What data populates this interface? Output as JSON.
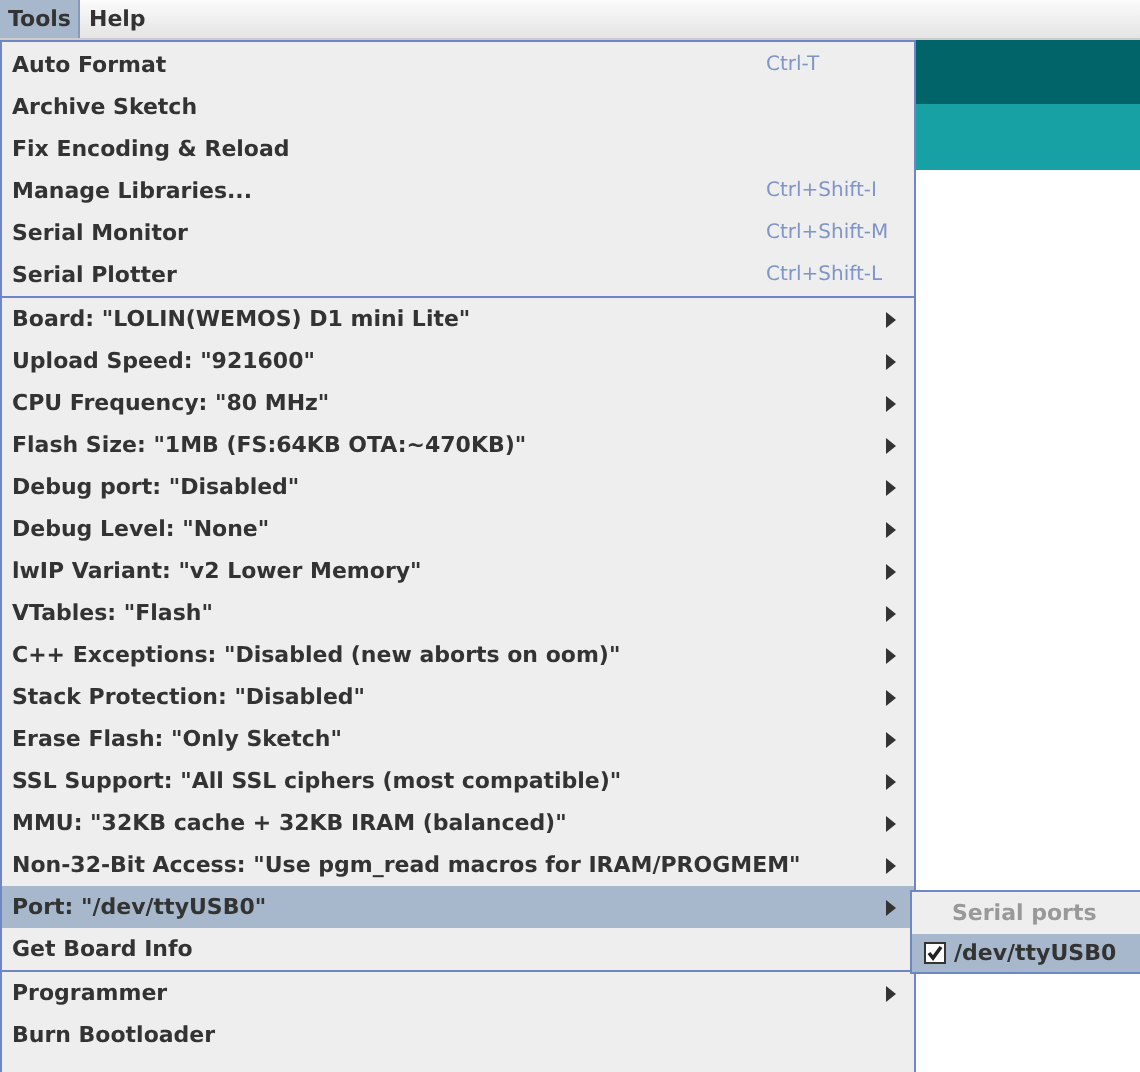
{
  "menubar": [
    {
      "label": "Tools",
      "selected": true
    },
    {
      "label": "Help",
      "selected": false
    }
  ],
  "menu_sections": [
    {
      "items": [
        {
          "label": "Auto Format",
          "shortcut": "Ctrl-T",
          "submenu": false,
          "selected": false
        },
        {
          "label": "Archive Sketch",
          "submenu": false,
          "selected": false
        },
        {
          "label": "Fix Encoding & Reload",
          "submenu": false,
          "selected": false
        },
        {
          "label": "Manage Libraries...",
          "shortcut": "Ctrl+Shift-I",
          "submenu": false,
          "selected": false
        },
        {
          "label": "Serial Monitor",
          "shortcut": "Ctrl+Shift-M",
          "submenu": false,
          "selected": false
        },
        {
          "label": "Serial Plotter",
          "shortcut": "Ctrl+Shift-L",
          "submenu": false,
          "selected": false
        }
      ]
    },
    {
      "items": [
        {
          "label": "Board: \"LOLIN(WEMOS) D1 mini Lite\"",
          "submenu": true,
          "selected": false
        },
        {
          "label": "Upload Speed: \"921600\"",
          "submenu": true,
          "selected": false
        },
        {
          "label": "CPU Frequency: \"80 MHz\"",
          "submenu": true,
          "selected": false
        },
        {
          "label": "Flash Size: \"1MB (FS:64KB OTA:~470KB)\"",
          "submenu": true,
          "selected": false
        },
        {
          "label": "Debug port: \"Disabled\"",
          "submenu": true,
          "selected": false
        },
        {
          "label": "Debug Level: \"None\"",
          "submenu": true,
          "selected": false
        },
        {
          "label": "lwIP Variant: \"v2 Lower Memory\"",
          "submenu": true,
          "selected": false
        },
        {
          "label": "VTables: \"Flash\"",
          "submenu": true,
          "selected": false
        },
        {
          "label": "C++ Exceptions: \"Disabled (new aborts on oom)\"",
          "submenu": true,
          "selected": false
        },
        {
          "label": "Stack Protection: \"Disabled\"",
          "submenu": true,
          "selected": false
        },
        {
          "label": "Erase Flash: \"Only Sketch\"",
          "submenu": true,
          "selected": false
        },
        {
          "label": "SSL Support: \"All SSL ciphers (most compatible)\"",
          "submenu": true,
          "selected": false
        },
        {
          "label": "MMU: \"32KB cache + 32KB IRAM (balanced)\"",
          "submenu": true,
          "selected": false
        },
        {
          "label": "Non-32-Bit Access: \"Use pgm_read macros for IRAM/PROGMEM\"",
          "submenu": true,
          "selected": false
        },
        {
          "label": "Port: \"/dev/ttyUSB0\"",
          "submenu": true,
          "selected": true
        },
        {
          "label": "Get Board Info",
          "submenu": false,
          "selected": false
        }
      ]
    },
    {
      "items": [
        {
          "label": "Programmer",
          "submenu": true,
          "selected": false
        },
        {
          "label": "Burn Bootloader",
          "submenu": false,
          "selected": false
        }
      ]
    }
  ],
  "submenu": {
    "header": "Serial ports",
    "items": [
      {
        "label": "/dev/ttyUSB0",
        "checked": true,
        "selected": true
      }
    ]
  }
}
